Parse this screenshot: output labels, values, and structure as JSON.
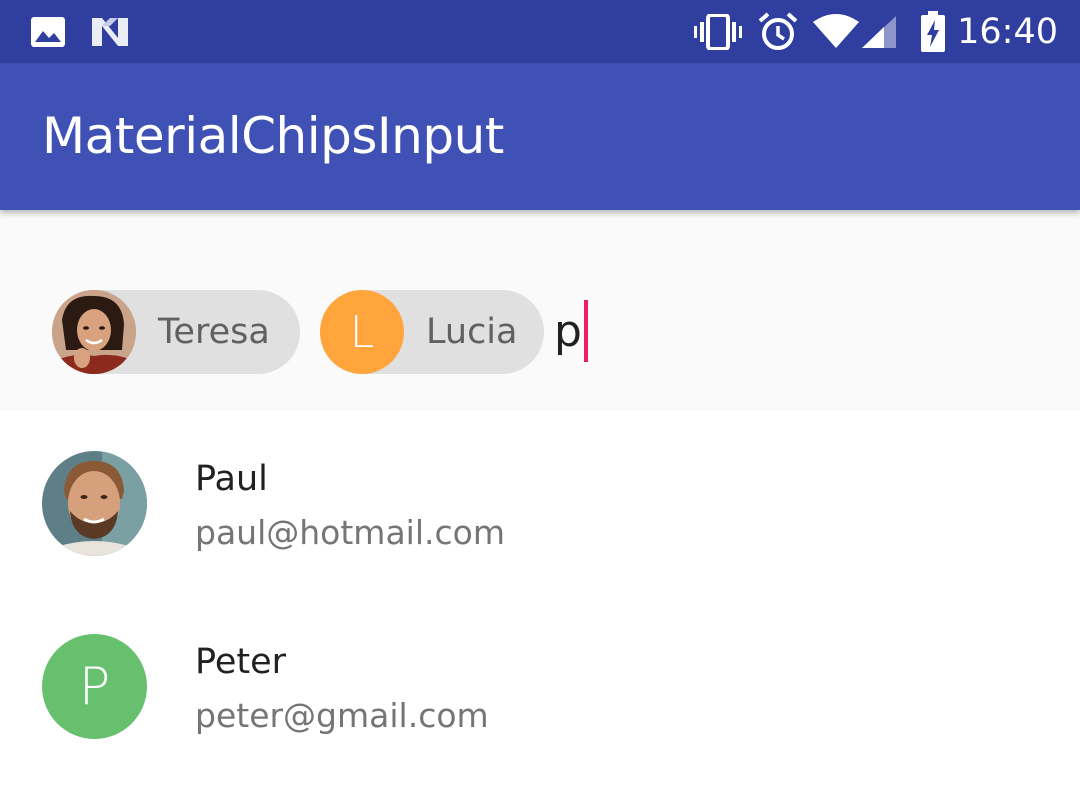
{
  "status_bar": {
    "time": "16:40",
    "icons": [
      "image-icon",
      "n-logo-icon",
      "vibrate-icon",
      "alarm-icon",
      "wifi-icon",
      "cell-signal-icon",
      "battery-charging-icon"
    ],
    "background": "#303f9f"
  },
  "app_bar": {
    "title": "MaterialChipsInput",
    "background": "#3f51b5"
  },
  "chips_input": {
    "chips": [
      {
        "label": "Teresa",
        "avatar": "photo"
      },
      {
        "label": "Lucia",
        "avatar_letter": "L",
        "avatar_color": "#ffa53b"
      }
    ],
    "typed_text": "p",
    "cursor_color": "#e91e63"
  },
  "suggestions": [
    {
      "name": "Paul",
      "email": "paul@hotmail.com",
      "avatar": "photo"
    },
    {
      "name": "Peter",
      "email": "peter@gmail.com",
      "avatar_letter": "P",
      "avatar_color": "#66c06e"
    }
  ]
}
